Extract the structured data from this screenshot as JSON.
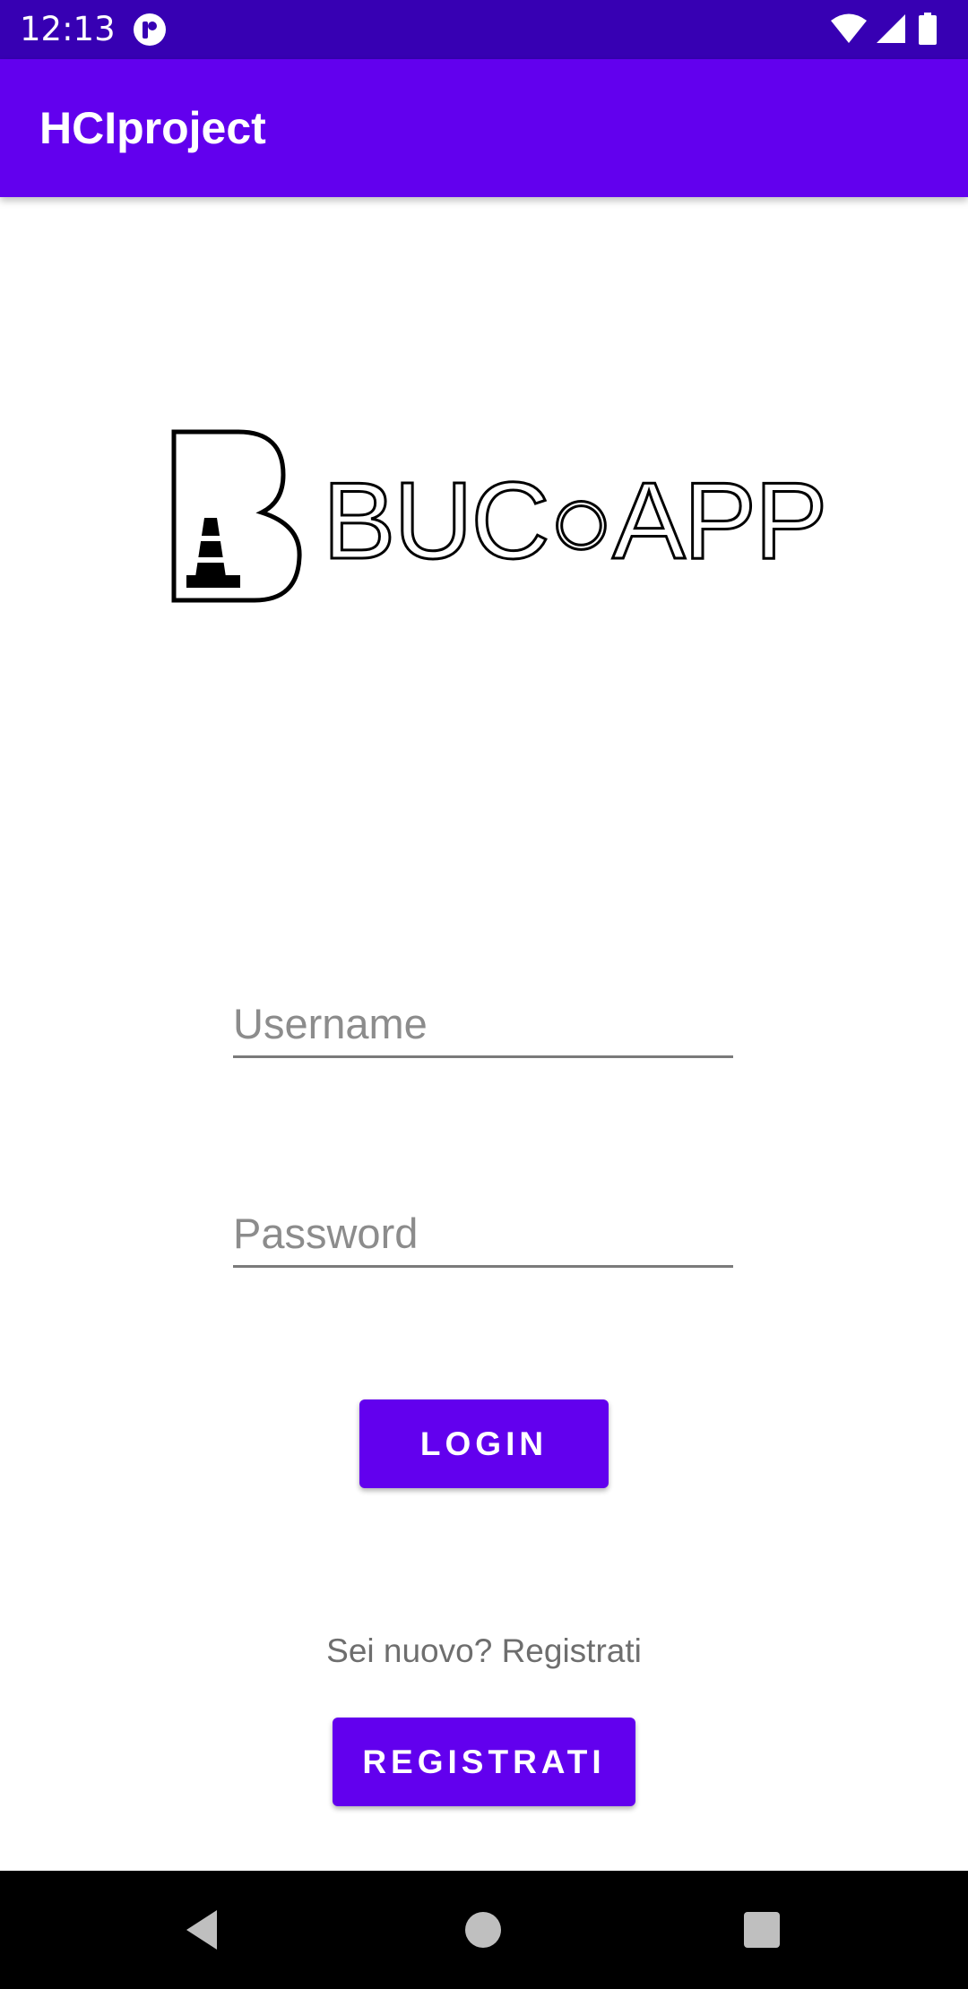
{
  "status_bar": {
    "time": "12:13",
    "icons": [
      "app-notification-icon",
      "wifi-icon",
      "cell-signal-icon",
      "battery-icon"
    ]
  },
  "app_bar": {
    "title": "HCIproject"
  },
  "logo": {
    "wordmark": "BUC○APP"
  },
  "form": {
    "username_placeholder": "Username",
    "username_value": "",
    "password_placeholder": "Password",
    "password_value": "",
    "login_label": "LOGIN",
    "register_prompt": "Sei nuovo? Registrati",
    "register_label": "REGISTRATI"
  },
  "nav_bar": {
    "icons": [
      "back-icon",
      "home-icon",
      "recents-icon"
    ]
  },
  "colors": {
    "status_bar": "#3700b3",
    "primary": "#6200ee",
    "on_primary": "#ffffff",
    "hint_text": "#8c8c8c",
    "secondary_text": "#6e6e6e",
    "nav_bar": "#000000"
  }
}
